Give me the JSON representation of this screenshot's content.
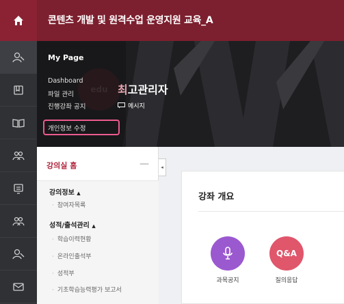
{
  "header": {
    "course_title": "콘텐츠 개발 및 원격수업 운영지원 교육_A"
  },
  "rail": {
    "icons": [
      "home-icon",
      "user-icon",
      "book-icon",
      "open-book-icon",
      "users-icon",
      "monitor-icon",
      "users-icon",
      "user-icon",
      "mail-icon"
    ]
  },
  "mypage": {
    "title": "My Page",
    "links": [
      "Dashboard",
      "파일 관리",
      "진행강좌 공지",
      "개인정보 수정"
    ]
  },
  "profile": {
    "name_char_prefix": "최",
    "name_rest": "고관리자",
    "message_label": "메시지",
    "avatar_watermark": "edu"
  },
  "sidenav": {
    "home_label": "강의실 홈",
    "collapse_symbol": "—",
    "sections": [
      {
        "label": "강의정보",
        "items": [
          "참여자목록"
        ]
      },
      {
        "label": "성적/출석관리",
        "items": [
          "학습이력현황",
          "온라인출석부",
          "성적부",
          "기초학습능력평가 보고서"
        ]
      }
    ]
  },
  "toggle_symbol": "◂",
  "main": {
    "card_title": "강좌 개요",
    "actions": [
      {
        "label": "과목공지",
        "color": "#9b59d0"
      },
      {
        "label": "질의응답",
        "icon_text": "Q&A",
        "color": "#e0566b"
      }
    ]
  },
  "colors": {
    "brand": "#7c1f2e",
    "highlight": "#ef5a8f",
    "home_label": "#b0223b"
  }
}
